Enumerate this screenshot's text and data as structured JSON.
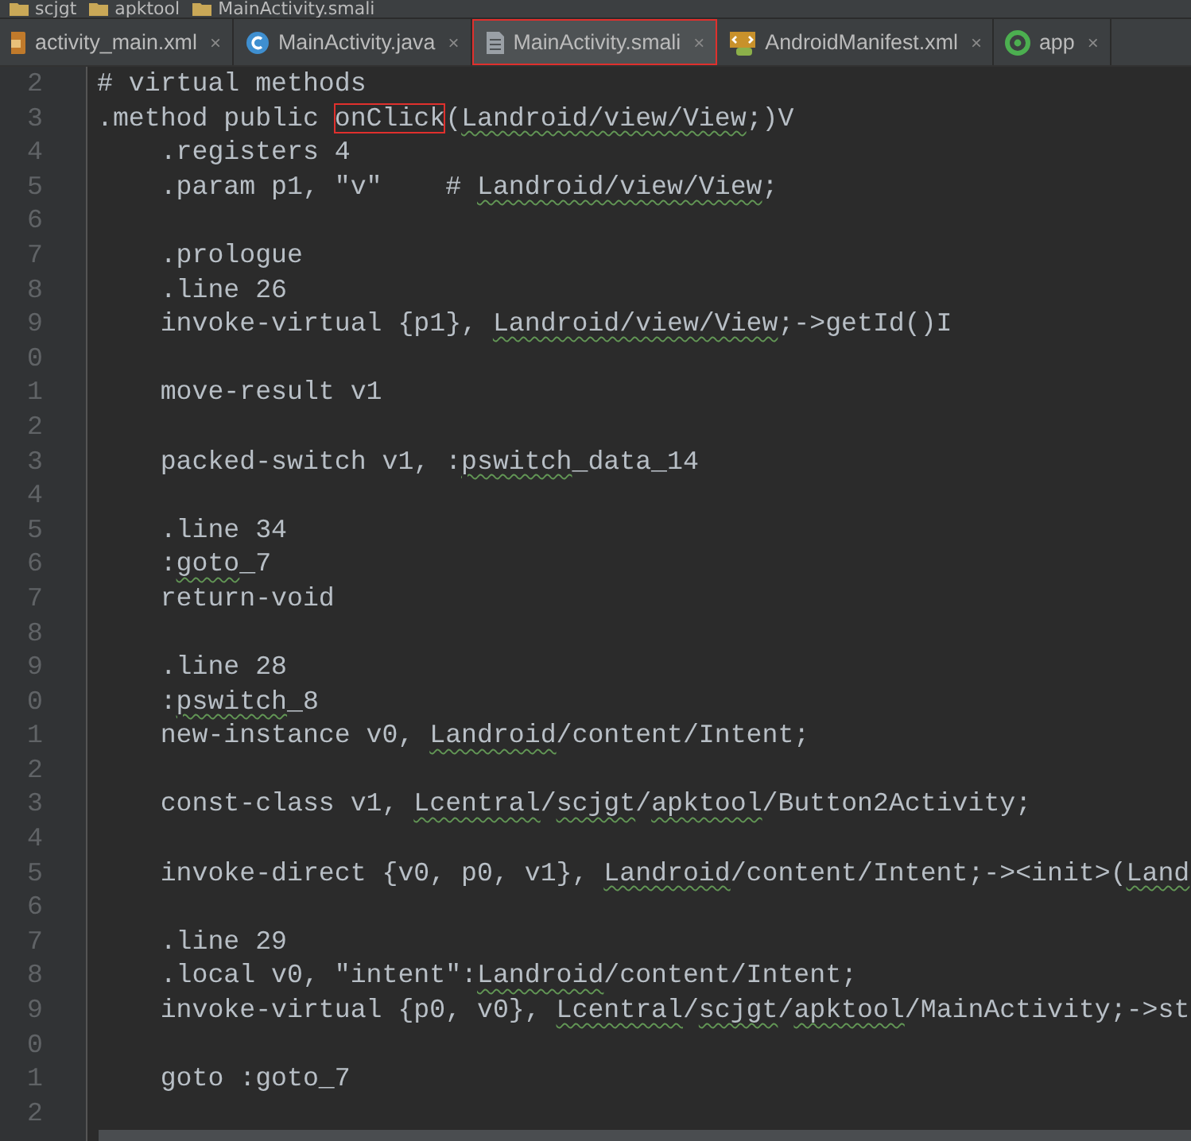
{
  "breadcrumbs": [
    {
      "label": "scjgt"
    },
    {
      "label": "apktool"
    },
    {
      "label": "MainActivity.smali"
    }
  ],
  "tabs": [
    {
      "label": "activity_main.xml",
      "kind": "xml",
      "selected": false,
      "highlighted": false,
      "close": "×"
    },
    {
      "label": "MainActivity.java",
      "kind": "class",
      "selected": false,
      "highlighted": false,
      "close": "×"
    },
    {
      "label": "MainActivity.smali",
      "kind": "file",
      "selected": true,
      "highlighted": true,
      "close": "×"
    },
    {
      "label": "AndroidManifest.xml",
      "kind": "manifest",
      "selected": false,
      "highlighted": false,
      "close": "×"
    },
    {
      "label": "app",
      "kind": "module",
      "selected": false,
      "highlighted": false,
      "close": "×"
    }
  ],
  "editor": {
    "lines": [
      {
        "number": "2",
        "segments": [
          {
            "text": "# virtual methods",
            "kind": "plain"
          }
        ]
      },
      {
        "number": "3",
        "segments": [
          {
            "text": ".method public ",
            "kind": "plain"
          },
          {
            "text": "onClick",
            "kind": "boxed"
          },
          {
            "text": "(",
            "kind": "plain"
          },
          {
            "text": "Landroid/view/View",
            "kind": "squiggle"
          },
          {
            "text": ";)V",
            "kind": "plain"
          }
        ]
      },
      {
        "number": "4",
        "segments": [
          {
            "text": "    .registers 4",
            "kind": "plain"
          }
        ]
      },
      {
        "number": "5",
        "segments": [
          {
            "text": "    .param p1, \"v\"    # ",
            "kind": "plain"
          },
          {
            "text": "Landroid/view/View",
            "kind": "squiggle"
          },
          {
            "text": ";",
            "kind": "plain"
          }
        ]
      },
      {
        "number": "6"
      },
      {
        "number": "7",
        "segments": [
          {
            "text": "    .prologue",
            "kind": "plain"
          }
        ]
      },
      {
        "number": "8",
        "segments": [
          {
            "text": "    .line 26",
            "kind": "plain"
          }
        ]
      },
      {
        "number": "9",
        "segments": [
          {
            "text": "    invoke-virtual {p1}, ",
            "kind": "plain"
          },
          {
            "text": "Landroid/view/View",
            "kind": "squiggle"
          },
          {
            "text": ";->getId()I",
            "kind": "plain"
          }
        ]
      },
      {
        "number": "0"
      },
      {
        "number": "1",
        "segments": [
          {
            "text": "    move-result v1",
            "kind": "plain"
          }
        ]
      },
      {
        "number": "2"
      },
      {
        "number": "3",
        "segments": [
          {
            "text": "    packed-switch v1, :",
            "kind": "plain"
          },
          {
            "text": "pswitch",
            "kind": "squiggle"
          },
          {
            "text": "_data_14",
            "kind": "plain"
          }
        ]
      },
      {
        "number": "4"
      },
      {
        "number": "5",
        "segments": [
          {
            "text": "    .line 34",
            "kind": "plain"
          }
        ]
      },
      {
        "number": "6",
        "segments": [
          {
            "text": "    :",
            "kind": "plain"
          },
          {
            "text": "goto",
            "kind": "squiggle"
          },
          {
            "text": "_7",
            "kind": "plain"
          }
        ]
      },
      {
        "number": "7",
        "segments": [
          {
            "text": "    return-void",
            "kind": "plain"
          }
        ]
      },
      {
        "number": "8"
      },
      {
        "number": "9",
        "segments": [
          {
            "text": "    .line 28",
            "kind": "plain"
          }
        ]
      },
      {
        "number": "0",
        "segments": [
          {
            "text": "    :",
            "kind": "plain"
          },
          {
            "text": "pswitch",
            "kind": "squiggle"
          },
          {
            "text": "_8",
            "kind": "plain"
          }
        ]
      },
      {
        "number": "1",
        "segments": [
          {
            "text": "    new-instance v0, ",
            "kind": "plain"
          },
          {
            "text": "Landroid",
            "kind": "squiggle"
          },
          {
            "text": "/content/Intent;",
            "kind": "plain"
          }
        ]
      },
      {
        "number": "2"
      },
      {
        "number": "3",
        "segments": [
          {
            "text": "    const-class v1, ",
            "kind": "plain"
          },
          {
            "text": "Lcentral",
            "kind": "squiggle"
          },
          {
            "text": "/",
            "kind": "plain"
          },
          {
            "text": "scjgt",
            "kind": "squiggle"
          },
          {
            "text": "/",
            "kind": "plain"
          },
          {
            "text": "apktool",
            "kind": "squiggle"
          },
          {
            "text": "/Button2Activity;",
            "kind": "plain"
          }
        ]
      },
      {
        "number": "4"
      },
      {
        "number": "5",
        "segments": [
          {
            "text": "    invoke-direct {v0, p0, v1}, ",
            "kind": "plain"
          },
          {
            "text": "Landroid",
            "kind": "squiggle"
          },
          {
            "text": "/content/Intent;-><init>(",
            "kind": "plain"
          },
          {
            "text": "Land",
            "kind": "squiggle"
          }
        ]
      },
      {
        "number": "6"
      },
      {
        "number": "7",
        "segments": [
          {
            "text": "    .line 29",
            "kind": "plain"
          }
        ]
      },
      {
        "number": "8",
        "segments": [
          {
            "text": "    .local v0, \"intent\":",
            "kind": "plain"
          },
          {
            "text": "Landroid",
            "kind": "squiggle"
          },
          {
            "text": "/content/Intent;",
            "kind": "plain"
          }
        ]
      },
      {
        "number": "9",
        "segments": [
          {
            "text": "    invoke-virtual {p0, v0}, ",
            "kind": "plain"
          },
          {
            "text": "Lcentral",
            "kind": "squiggle"
          },
          {
            "text": "/",
            "kind": "plain"
          },
          {
            "text": "scjgt",
            "kind": "squiggle"
          },
          {
            "text": "/",
            "kind": "plain"
          },
          {
            "text": "apktool",
            "kind": "squiggle"
          },
          {
            "text": "/MainActivity;->st",
            "kind": "plain"
          }
        ]
      },
      {
        "number": "0"
      },
      {
        "number": "1",
        "segments": [
          {
            "text": "    goto :goto_7",
            "kind": "plain"
          }
        ]
      },
      {
        "number": "2"
      }
    ]
  }
}
